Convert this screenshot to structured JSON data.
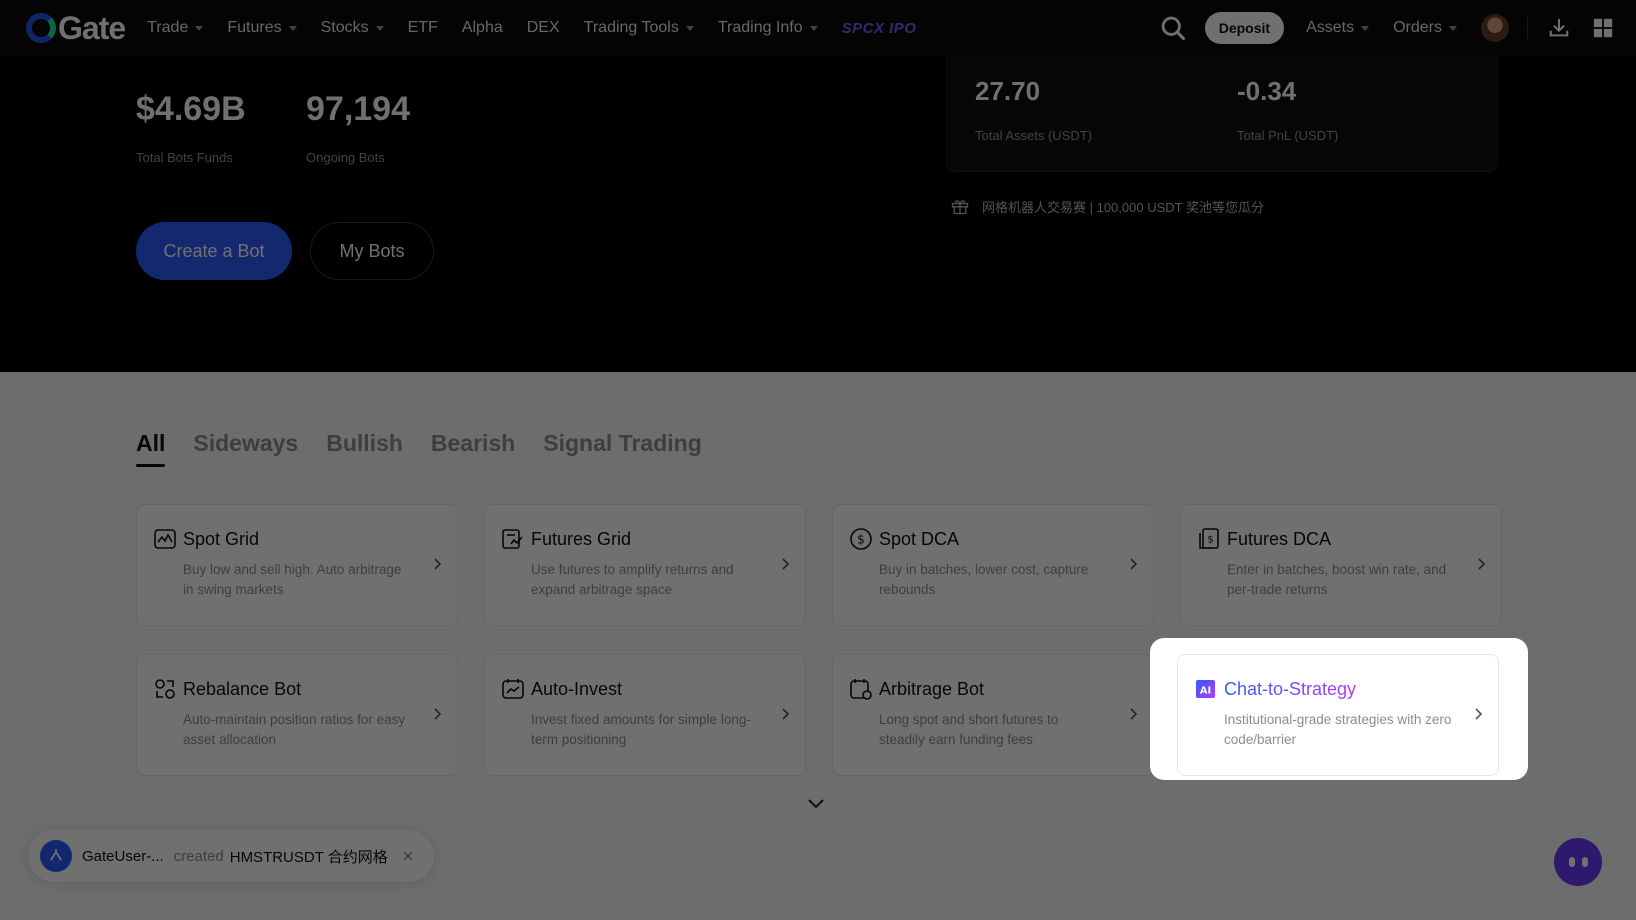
{
  "nav": {
    "logo_text": "Gate",
    "items": [
      "Trade",
      "Futures",
      "Stocks",
      "ETF",
      "Alpha",
      "DEX",
      "Trading Tools",
      "Trading Info"
    ],
    "promo": "SPCX IPO",
    "deposit": "Deposit",
    "assets": "Assets",
    "orders": "Orders"
  },
  "hero": {
    "total_funds_value": "$4.69B",
    "total_funds_label": "Total Bots Funds",
    "ongoing_value": "97,194",
    "ongoing_label": "Ongoing Bots",
    "create_button": "Create a Bot",
    "my_bots_button": "My Bots",
    "total_assets_value": "27.70",
    "total_assets_label": "Total Assets (USDT)",
    "total_pnl_value": "-0.34",
    "total_pnl_label": "Total PnL (USDT)",
    "promo_text": "网格机器人交易赛 | 100,000 USDT 奖池等您瓜分"
  },
  "tabs": [
    "All",
    "Sideways",
    "Bullish",
    "Bearish",
    "Signal Trading"
  ],
  "active_tab": "All",
  "bots": [
    {
      "title": "Spot Grid",
      "desc": "Buy low and sell high. Auto arbitrage in swing markets",
      "icon": "spot-grid-icon"
    },
    {
      "title": "Futures Grid",
      "desc": "Use futures to amplify returns and expand arbitrage space",
      "icon": "futures-grid-icon"
    },
    {
      "title": "Spot DCA",
      "desc": "Buy in batches, lower cost, capture rebounds",
      "icon": "spot-dca-icon"
    },
    {
      "title": "Futures DCA",
      "desc": "Enter in batches, boost win rate, and per-trade returns",
      "icon": "futures-dca-icon"
    },
    {
      "title": "Rebalance Bot",
      "desc": "Auto-maintain position ratios for easy asset allocation",
      "icon": "rebalance-icon"
    },
    {
      "title": "Auto-Invest",
      "desc": "Invest fixed amounts for simple long-term positioning",
      "icon": "auto-invest-icon"
    },
    {
      "title": "Arbitrage Bot",
      "desc": "Long spot and short futures to steadily earn funding fees",
      "icon": "arbitrage-icon"
    },
    {
      "title": "Chat-to-Strategy",
      "desc": "Institutional-grade strategies with zero code/barrier",
      "icon": "ai-icon"
    }
  ],
  "toast": {
    "user": "GateUser-...",
    "verb": "created",
    "object": "HMSTRUSDT 合约网格"
  },
  "colors": {
    "accent": "#2f5bff",
    "gradient_end": "#b43cf5",
    "promo_purple": "#7b5cff"
  }
}
